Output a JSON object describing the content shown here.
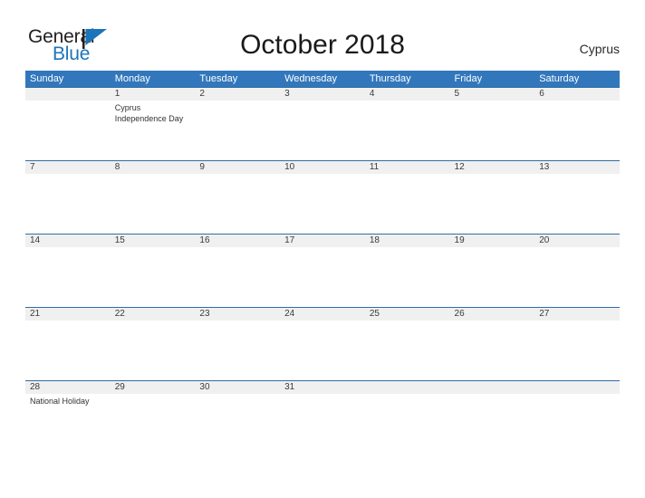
{
  "brand": {
    "name_part1": "General",
    "name_part2": "Blue",
    "flag_icon": "blue-flag-triangle-icon",
    "color_dark": "#231f20",
    "color_blue": "#1b75bb"
  },
  "header": {
    "title": "October 2018",
    "country": "Cyprus",
    "header_bg_color": "#3277bc",
    "row_divider_color": "#2e6da4",
    "date_band_color": "#f0f0f0"
  },
  "weekdays": [
    "Sunday",
    "Monday",
    "Tuesday",
    "Wednesday",
    "Thursday",
    "Friday",
    "Saturday"
  ],
  "weeks": [
    {
      "days": [
        {
          "date": "",
          "event": ""
        },
        {
          "date": "1",
          "event": "Cyprus Independence Day"
        },
        {
          "date": "2",
          "event": ""
        },
        {
          "date": "3",
          "event": ""
        },
        {
          "date": "4",
          "event": ""
        },
        {
          "date": "5",
          "event": ""
        },
        {
          "date": "6",
          "event": ""
        }
      ]
    },
    {
      "days": [
        {
          "date": "7",
          "event": ""
        },
        {
          "date": "8",
          "event": ""
        },
        {
          "date": "9",
          "event": ""
        },
        {
          "date": "10",
          "event": ""
        },
        {
          "date": "11",
          "event": ""
        },
        {
          "date": "12",
          "event": ""
        },
        {
          "date": "13",
          "event": ""
        }
      ]
    },
    {
      "days": [
        {
          "date": "14",
          "event": ""
        },
        {
          "date": "15",
          "event": ""
        },
        {
          "date": "16",
          "event": ""
        },
        {
          "date": "17",
          "event": ""
        },
        {
          "date": "18",
          "event": ""
        },
        {
          "date": "19",
          "event": ""
        },
        {
          "date": "20",
          "event": ""
        }
      ]
    },
    {
      "days": [
        {
          "date": "21",
          "event": ""
        },
        {
          "date": "22",
          "event": ""
        },
        {
          "date": "23",
          "event": ""
        },
        {
          "date": "24",
          "event": ""
        },
        {
          "date": "25",
          "event": ""
        },
        {
          "date": "26",
          "event": ""
        },
        {
          "date": "27",
          "event": ""
        }
      ]
    },
    {
      "days": [
        {
          "date": "28",
          "event": "National Holiday"
        },
        {
          "date": "29",
          "event": ""
        },
        {
          "date": "30",
          "event": ""
        },
        {
          "date": "31",
          "event": ""
        },
        {
          "date": "",
          "event": ""
        },
        {
          "date": "",
          "event": ""
        },
        {
          "date": "",
          "event": ""
        }
      ]
    }
  ]
}
